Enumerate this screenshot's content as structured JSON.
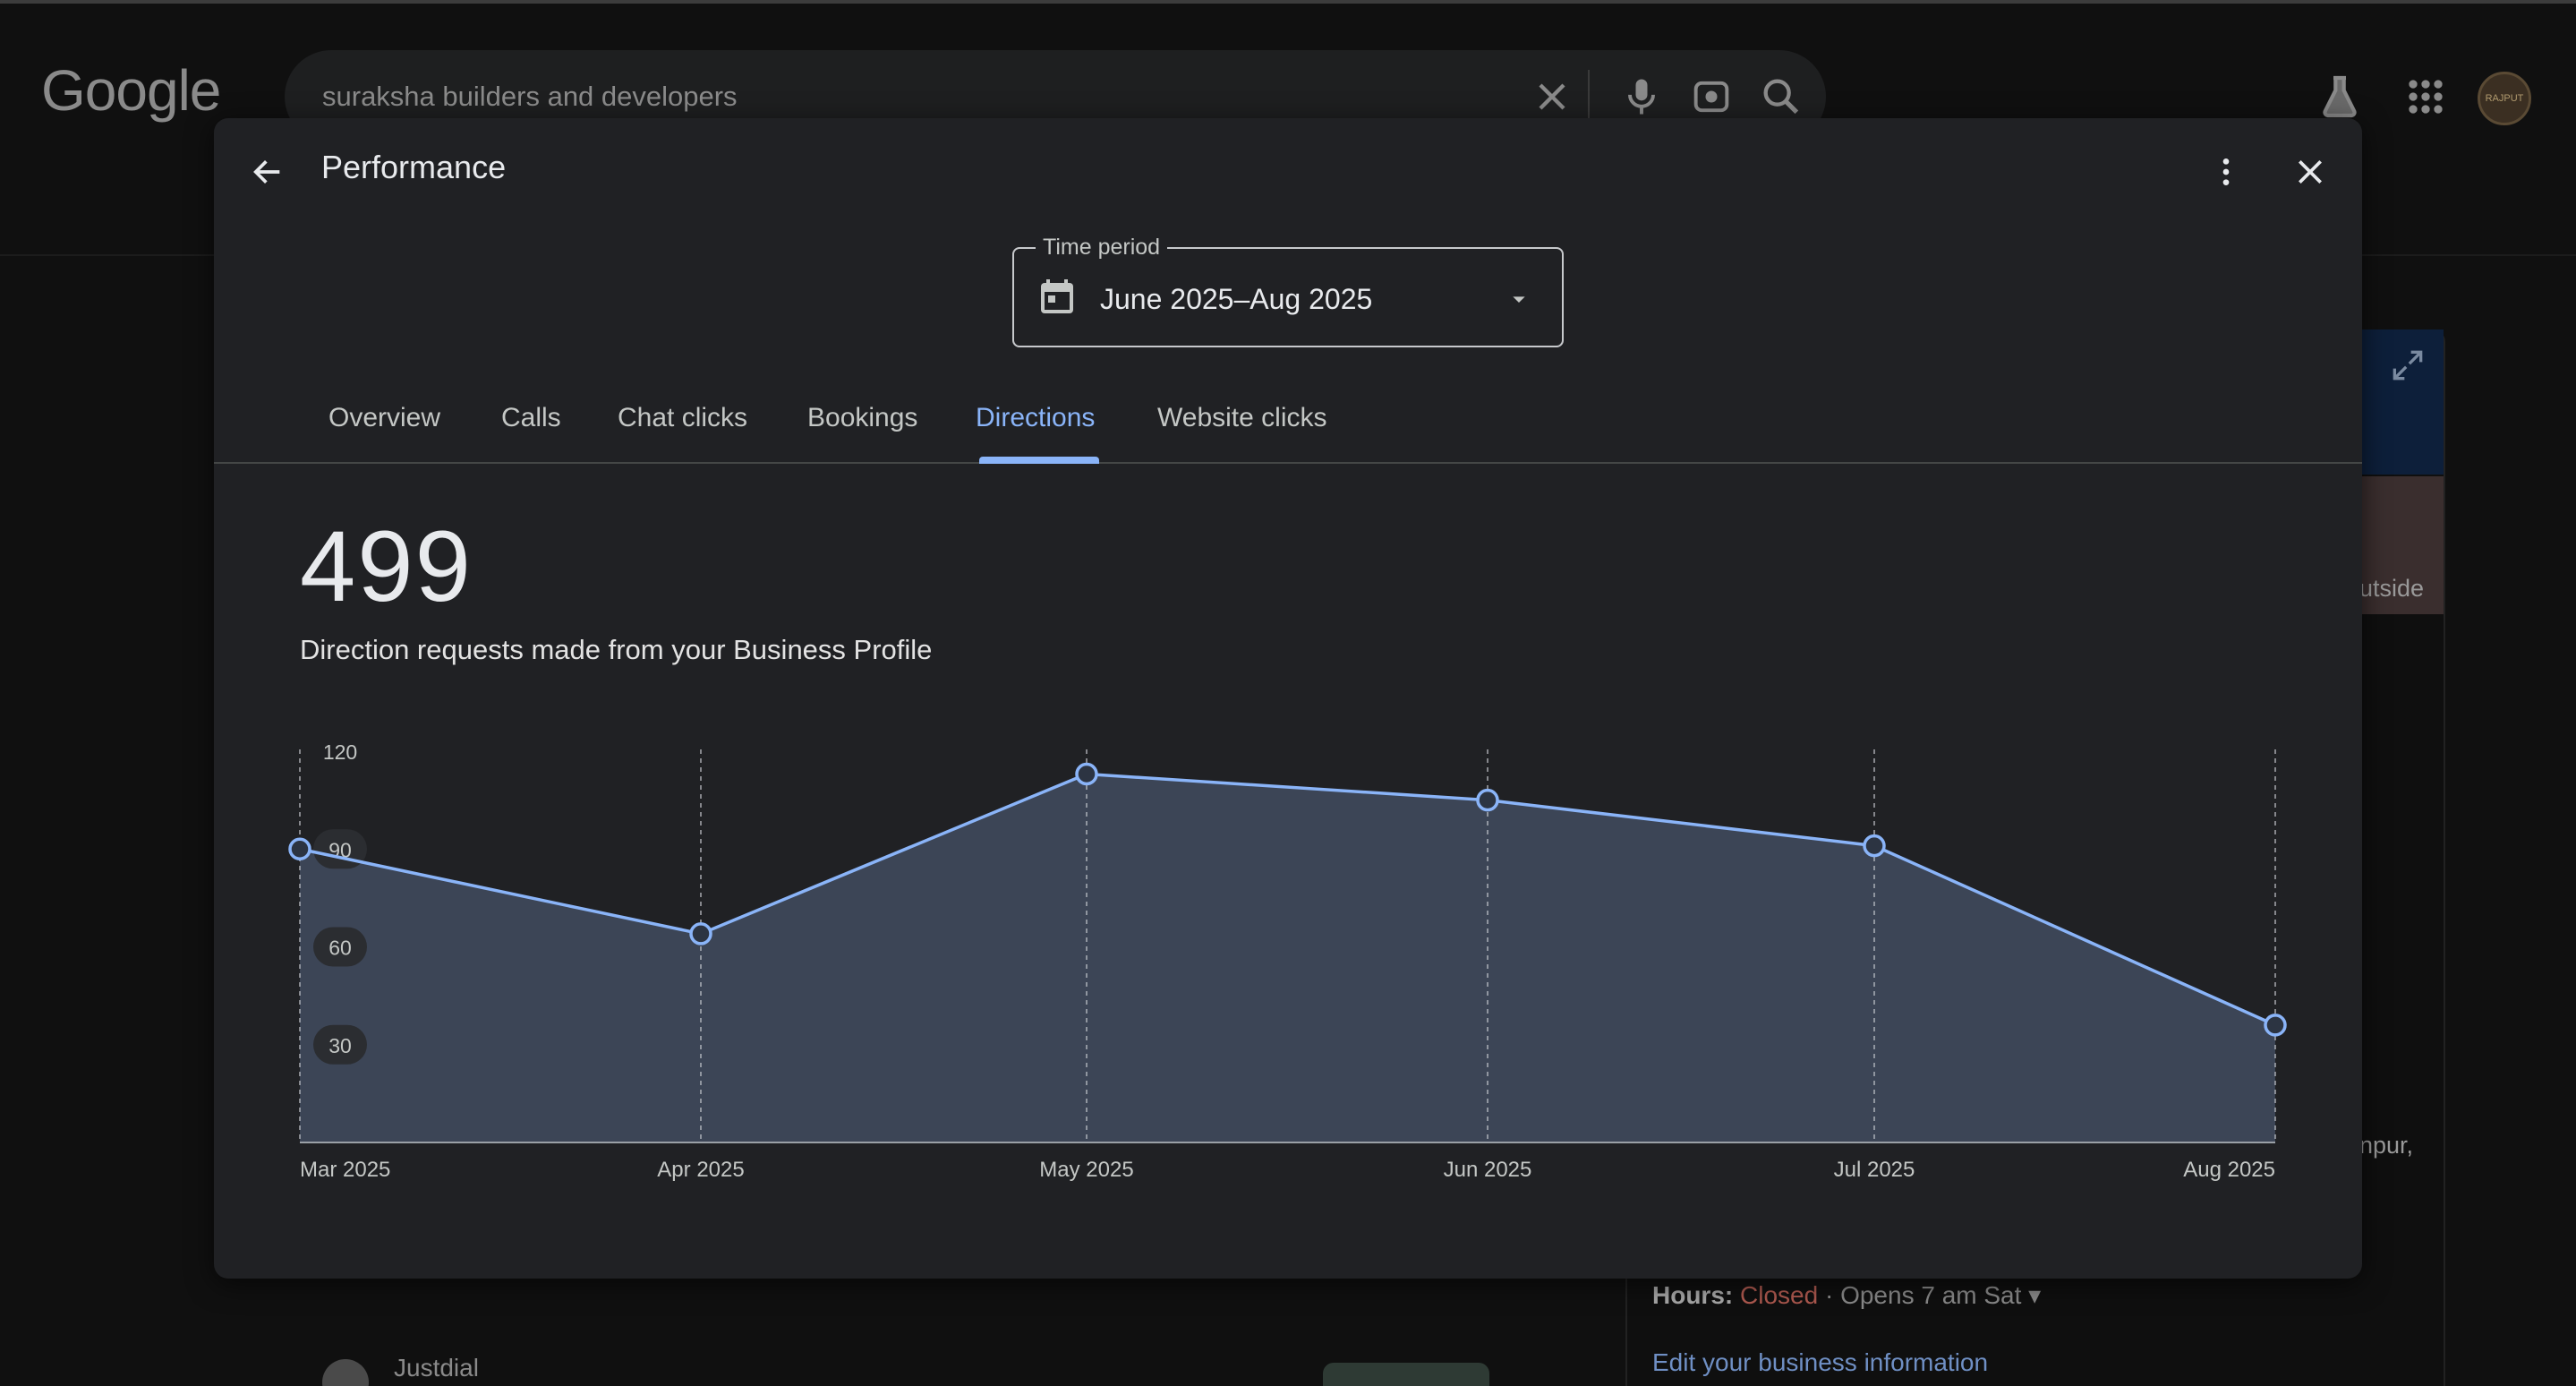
{
  "serp": {
    "logo": "Google",
    "search_query": "suraksha builders and developers",
    "avatar_text": "RAJPUT",
    "panel": {
      "fragment_1": "utside",
      "fragment_2": "npur,",
      "hours_label": "Hours:",
      "hours_status": "Closed",
      "hours_detail": " · Opens 7 am Sat ▾",
      "edit_link": "Edit your business information"
    },
    "result_source": "Justdial"
  },
  "dialog": {
    "title": "Performance",
    "time_period": {
      "label": "Time period",
      "value": "June 2025–Aug 2025"
    },
    "tabs": [
      {
        "label": "Overview",
        "active": false
      },
      {
        "label": "Calls",
        "active": false
      },
      {
        "label": "Chat clicks",
        "active": false
      },
      {
        "label": "Bookings",
        "active": false
      },
      {
        "label": "Directions",
        "active": true
      },
      {
        "label": "Website clicks",
        "active": false
      }
    ],
    "metric": {
      "total": "499",
      "description": "Direction requests made from your Business Profile"
    }
  },
  "colors": {
    "accent": "#8ab4f8",
    "dialog_bg": "#202124",
    "area_fill": "#3c4556"
  },
  "chart_data": {
    "type": "area",
    "x": [
      "Mar 2025",
      "Apr 2025",
      "May 2025",
      "Jun 2025",
      "Jul 2025",
      "Aug 2025"
    ],
    "series": [
      {
        "values": [
          90,
          64,
          113,
          105,
          91,
          36
        ]
      }
    ],
    "y_ticks": [
      "120",
      "90",
      "60",
      "30"
    ],
    "ylim": [
      0,
      120
    ],
    "grid": "vertical dashed"
  }
}
